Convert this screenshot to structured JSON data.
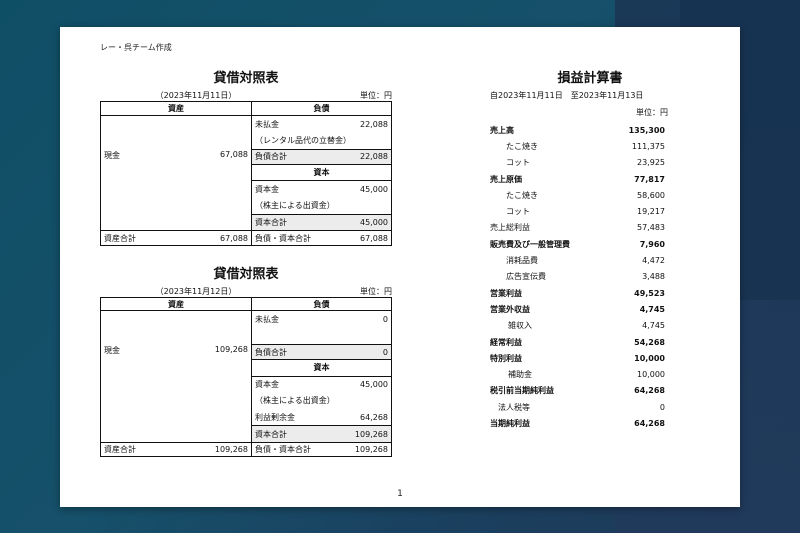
{
  "author": "レー・呉チーム作成",
  "page_number": "1",
  "balance_sheets": [
    {
      "title": "貸借対照表",
      "date": "（2023年11月11日）",
      "unit": "単位：円",
      "asset_header": "資産",
      "liability_header": "負債",
      "cash_label": "現金",
      "cash_value": "67,088",
      "right_rows": [
        {
          "label": "未払金",
          "value": "22,088",
          "type": "item"
        },
        {
          "label": "（レンタル品代の立替金）",
          "value": "",
          "type": "item"
        },
        {
          "label": "負債合計",
          "value": "22,088",
          "type": "total"
        },
        {
          "label": "資本",
          "value": "",
          "type": "section"
        },
        {
          "label": "資本金",
          "value": "45,000",
          "type": "item"
        },
        {
          "label": "（株主による出資金）",
          "value": "",
          "type": "item"
        },
        {
          "label": "資本合計",
          "value": "45,000",
          "type": "total-last"
        }
      ],
      "asset_total_label": "資産合計",
      "asset_total_value": "67,088",
      "liab_cap_total_label": "負債・資本合計",
      "liab_cap_total_value": "67,088"
    },
    {
      "title": "貸借対照表",
      "date": "（2023年11月12日）",
      "unit": "単位：円",
      "asset_header": "資産",
      "liability_header": "負債",
      "cash_label": "現金",
      "cash_value": "109,268",
      "right_rows": [
        {
          "label": "未払金",
          "value": "0",
          "type": "item"
        },
        {
          "label": "",
          "value": "",
          "type": "item"
        },
        {
          "label": "負債合計",
          "value": "0",
          "type": "total"
        },
        {
          "label": "資本",
          "value": "",
          "type": "section"
        },
        {
          "label": "資本金",
          "value": "45,000",
          "type": "item"
        },
        {
          "label": "（株主による出資金）",
          "value": "",
          "type": "item"
        },
        {
          "label": "利益剰余金",
          "value": "64,268",
          "type": "item"
        },
        {
          "label": "資本合計",
          "value": "109,268",
          "type": "total-last"
        }
      ],
      "asset_total_label": "資産合計",
      "asset_total_value": "109,268",
      "liab_cap_total_label": "負債・資本合計",
      "liab_cap_total_value": "109,268"
    }
  ],
  "income_statement": {
    "title": "損益計算書",
    "period": "自2023年11月11日　至2023年11月13日",
    "unit": "単位：円",
    "rows": [
      {
        "label": "売上高",
        "value": "135,300",
        "bold": true,
        "indent": 0
      },
      {
        "label": "たこ焼き",
        "value": "111,375",
        "bold": false,
        "indent": 2
      },
      {
        "label": "コット",
        "value": "23,925",
        "bold": false,
        "indent": 2
      },
      {
        "label": "売上原価",
        "value": "77,817",
        "bold": true,
        "indent": 0
      },
      {
        "label": "たこ焼き",
        "value": "58,600",
        "bold": false,
        "indent": 2
      },
      {
        "label": "コット",
        "value": "19,217",
        "bold": false,
        "indent": 2
      },
      {
        "label": "売上総利益",
        "value": "57,483",
        "bold": false,
        "indent": 0
      },
      {
        "label": "販売費及び一般管理費",
        "value": "7,960",
        "bold": true,
        "indent": 0
      },
      {
        "label": "消耗品費",
        "value": "4,472",
        "bold": false,
        "indent": 2
      },
      {
        "label": "広告宣伝費",
        "value": "3,488",
        "bold": false,
        "indent": 2
      },
      {
        "label": "営業利益",
        "value": "49,523",
        "bold": true,
        "indent": 0
      },
      {
        "label": "営業外収益",
        "value": "4,745",
        "bold": true,
        "indent": 0
      },
      {
        "label": "雑収入",
        "value": "4,745",
        "bold": false,
        "indent": 1
      },
      {
        "label": "経常利益",
        "value": "54,268",
        "bold": true,
        "indent": 0
      },
      {
        "label": "特別利益",
        "value": "10,000",
        "bold": true,
        "indent": 0
      },
      {
        "label": "補助金",
        "value": "10,000",
        "bold": false,
        "indent": 1
      },
      {
        "label": "税引前当期純利益",
        "value": "64,268",
        "bold": true,
        "indent": 0
      },
      {
        "label": "法人税等",
        "value": "0",
        "bold": false,
        "indent": 3
      },
      {
        "label": "当期純利益",
        "value": "64,268",
        "bold": true,
        "indent": 0
      }
    ]
  }
}
